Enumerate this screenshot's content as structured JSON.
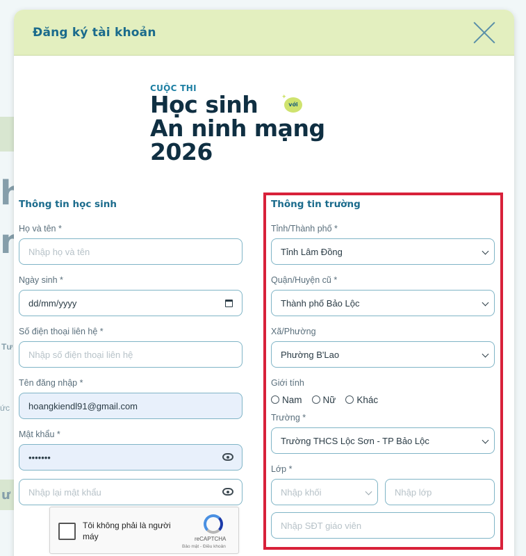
{
  "modal": {
    "title": "Đăng ký tài khoản"
  },
  "logo": {
    "pre": "CUỘC THI",
    "line1": "Học sinh",
    "badge": "với",
    "line2": "An ninh mạng",
    "line3": "2026"
  },
  "student": {
    "section_title": "Thông tin học sinh",
    "fullname": {
      "label": "Họ và tên *",
      "placeholder": "Nhập họ và tên"
    },
    "dob": {
      "label": "Ngày sinh *",
      "value": "dd/mm/yyyy"
    },
    "phone": {
      "label": "Số điện thoại liên hệ *",
      "placeholder": "Nhập số điện thoại liên hệ"
    },
    "username": {
      "label": "Tên đăng nhập *",
      "value": "hoangkiendl91@gmail.com"
    },
    "password": {
      "label": "Mật khẩu *",
      "value": "•••••••"
    },
    "confirm_password": {
      "placeholder": "Nhập lại mật khẩu"
    }
  },
  "school": {
    "section_title": "Thông tin trường",
    "province": {
      "label": "Tỉnh/Thành phố *",
      "value": "Tỉnh Lâm Đồng"
    },
    "district": {
      "label": "Quận/Huyện cũ *",
      "value": "Thành phố Bảo Lộc"
    },
    "ward": {
      "label": "Xã/Phường",
      "value": "Phường B'Lao"
    },
    "gender": {
      "label": "Giới tính",
      "options": [
        "Nam",
        "Nữ",
        "Khác"
      ]
    },
    "school": {
      "label": "Trường *",
      "value": "Trường THCS Lộc Sơn - TP Bảo Lộc"
    },
    "class": {
      "label": "Lớp *",
      "grade_placeholder": "Nhập khối",
      "class_placeholder": "Nhập lớp"
    },
    "teacher_phone": {
      "placeholder": "Nhập SĐT giáo viên"
    }
  },
  "captcha": {
    "label": "Tôi không phải là người máy",
    "brand": "reCAPTCHA",
    "terms": "Bảo mật - Điều khoản"
  },
  "background": {
    "letters": [
      "h",
      "n",
      "Tư",
      "ức",
      "ư"
    ]
  },
  "colors": {
    "header_bg": "#e3efbf",
    "accent": "#1b6b8c",
    "highlight": "#d8213a",
    "input_border": "#7fb4c6"
  }
}
